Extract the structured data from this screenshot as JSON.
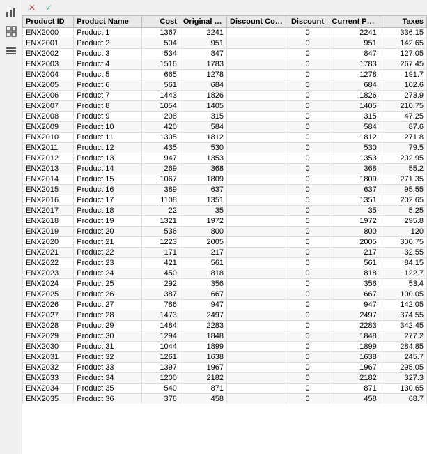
{
  "toolbar": {
    "chart_icon": "📊",
    "x_label": "✕",
    "check_label": "✓",
    "grid_icon": "⊞",
    "list_icon": "≡",
    "settings_icon": "⚙"
  },
  "table": {
    "columns": [
      {
        "key": "id",
        "label": "Product ID",
        "class": ""
      },
      {
        "key": "name",
        "label": "Product Name",
        "class": ""
      },
      {
        "key": "cost",
        "label": "Cost",
        "class": "num"
      },
      {
        "key": "orig_price",
        "label": "Original Sale Price",
        "class": "num"
      },
      {
        "key": "disc_code",
        "label": "Discount Code",
        "class": "center"
      },
      {
        "key": "discount",
        "label": "Discount",
        "class": "center"
      },
      {
        "key": "curr_price",
        "label": "Current Price",
        "class": "num"
      },
      {
        "key": "taxes",
        "label": "Taxes",
        "class": "num"
      }
    ],
    "rows": [
      {
        "id": "ENX2000",
        "name": "Product 1",
        "cost": "1367",
        "orig_price": "2241",
        "disc_code": "",
        "discount": "0",
        "curr_price": "2241",
        "taxes": "336.15"
      },
      {
        "id": "ENX2001",
        "name": "Product 2",
        "cost": "504",
        "orig_price": "951",
        "disc_code": "",
        "discount": "0",
        "curr_price": "951",
        "taxes": "142.65"
      },
      {
        "id": "ENX2002",
        "name": "Product 3",
        "cost": "534",
        "orig_price": "847",
        "disc_code": "",
        "discount": "0",
        "curr_price": "847",
        "taxes": "127.05"
      },
      {
        "id": "ENX2003",
        "name": "Product 4",
        "cost": "1516",
        "orig_price": "1783",
        "disc_code": "",
        "discount": "0",
        "curr_price": "1783",
        "taxes": "267.45"
      },
      {
        "id": "ENX2004",
        "name": "Product 5",
        "cost": "665",
        "orig_price": "1278",
        "disc_code": "",
        "discount": "0",
        "curr_price": "1278",
        "taxes": "191.7"
      },
      {
        "id": "ENX2005",
        "name": "Product 6",
        "cost": "561",
        "orig_price": "684",
        "disc_code": "",
        "discount": "0",
        "curr_price": "684",
        "taxes": "102.6"
      },
      {
        "id": "ENX2006",
        "name": "Product 7",
        "cost": "1443",
        "orig_price": "1826",
        "disc_code": "",
        "discount": "0",
        "curr_price": "1826",
        "taxes": "273.9"
      },
      {
        "id": "ENX2007",
        "name": "Product 8",
        "cost": "1054",
        "orig_price": "1405",
        "disc_code": "",
        "discount": "0",
        "curr_price": "1405",
        "taxes": "210.75"
      },
      {
        "id": "ENX2008",
        "name": "Product 9",
        "cost": "208",
        "orig_price": "315",
        "disc_code": "",
        "discount": "0",
        "curr_price": "315",
        "taxes": "47.25"
      },
      {
        "id": "ENX2009",
        "name": "Product 10",
        "cost": "420",
        "orig_price": "584",
        "disc_code": "",
        "discount": "0",
        "curr_price": "584",
        "taxes": "87.6"
      },
      {
        "id": "ENX2010",
        "name": "Product 11",
        "cost": "1305",
        "orig_price": "1812",
        "disc_code": "",
        "discount": "0",
        "curr_price": "1812",
        "taxes": "271.8"
      },
      {
        "id": "ENX2011",
        "name": "Product 12",
        "cost": "435",
        "orig_price": "530",
        "disc_code": "",
        "discount": "0",
        "curr_price": "530",
        "taxes": "79.5"
      },
      {
        "id": "ENX2012",
        "name": "Product 13",
        "cost": "947",
        "orig_price": "1353",
        "disc_code": "",
        "discount": "0",
        "curr_price": "1353",
        "taxes": "202.95"
      },
      {
        "id": "ENX2013",
        "name": "Product 14",
        "cost": "269",
        "orig_price": "368",
        "disc_code": "",
        "discount": "0",
        "curr_price": "368",
        "taxes": "55.2"
      },
      {
        "id": "ENX2014",
        "name": "Product 15",
        "cost": "1067",
        "orig_price": "1809",
        "disc_code": "",
        "discount": "0",
        "curr_price": "1809",
        "taxes": "271.35"
      },
      {
        "id": "ENX2015",
        "name": "Product 16",
        "cost": "389",
        "orig_price": "637",
        "disc_code": "",
        "discount": "0",
        "curr_price": "637",
        "taxes": "95.55"
      },
      {
        "id": "ENX2016",
        "name": "Product 17",
        "cost": "1108",
        "orig_price": "1351",
        "disc_code": "",
        "discount": "0",
        "curr_price": "1351",
        "taxes": "202.65"
      },
      {
        "id": "ENX2017",
        "name": "Product 18",
        "cost": "22",
        "orig_price": "35",
        "disc_code": "",
        "discount": "0",
        "curr_price": "35",
        "taxes": "5.25"
      },
      {
        "id": "ENX2018",
        "name": "Product 19",
        "cost": "1321",
        "orig_price": "1972",
        "disc_code": "",
        "discount": "0",
        "curr_price": "1972",
        "taxes": "295.8"
      },
      {
        "id": "ENX2019",
        "name": "Product 20",
        "cost": "536",
        "orig_price": "800",
        "disc_code": "",
        "discount": "0",
        "curr_price": "800",
        "taxes": "120"
      },
      {
        "id": "ENX2020",
        "name": "Product 21",
        "cost": "1223",
        "orig_price": "2005",
        "disc_code": "",
        "discount": "0",
        "curr_price": "2005",
        "taxes": "300.75"
      },
      {
        "id": "ENX2021",
        "name": "Product 22",
        "cost": "171",
        "orig_price": "217",
        "disc_code": "",
        "discount": "0",
        "curr_price": "217",
        "taxes": "32.55"
      },
      {
        "id": "ENX2022",
        "name": "Product 23",
        "cost": "421",
        "orig_price": "561",
        "disc_code": "",
        "discount": "0",
        "curr_price": "561",
        "taxes": "84.15"
      },
      {
        "id": "ENX2023",
        "name": "Product 24",
        "cost": "450",
        "orig_price": "818",
        "disc_code": "",
        "discount": "0",
        "curr_price": "818",
        "taxes": "122.7"
      },
      {
        "id": "ENX2024",
        "name": "Product 25",
        "cost": "292",
        "orig_price": "356",
        "disc_code": "",
        "discount": "0",
        "curr_price": "356",
        "taxes": "53.4"
      },
      {
        "id": "ENX2025",
        "name": "Product 26",
        "cost": "387",
        "orig_price": "667",
        "disc_code": "",
        "discount": "0",
        "curr_price": "667",
        "taxes": "100.05"
      },
      {
        "id": "ENX2026",
        "name": "Product 27",
        "cost": "786",
        "orig_price": "947",
        "disc_code": "",
        "discount": "0",
        "curr_price": "947",
        "taxes": "142.05"
      },
      {
        "id": "ENX2027",
        "name": "Product 28",
        "cost": "1473",
        "orig_price": "2497",
        "disc_code": "",
        "discount": "0",
        "curr_price": "2497",
        "taxes": "374.55"
      },
      {
        "id": "ENX2028",
        "name": "Product 29",
        "cost": "1484",
        "orig_price": "2283",
        "disc_code": "",
        "discount": "0",
        "curr_price": "2283",
        "taxes": "342.45"
      },
      {
        "id": "ENX2029",
        "name": "Product 30",
        "cost": "1294",
        "orig_price": "1848",
        "disc_code": "",
        "discount": "0",
        "curr_price": "1848",
        "taxes": "277.2"
      },
      {
        "id": "ENX2030",
        "name": "Product 31",
        "cost": "1044",
        "orig_price": "1899",
        "disc_code": "",
        "discount": "0",
        "curr_price": "1899",
        "taxes": "284.85"
      },
      {
        "id": "ENX2031",
        "name": "Product 32",
        "cost": "1261",
        "orig_price": "1638",
        "disc_code": "",
        "discount": "0",
        "curr_price": "1638",
        "taxes": "245.7"
      },
      {
        "id": "ENX2032",
        "name": "Product 33",
        "cost": "1397",
        "orig_price": "1967",
        "disc_code": "",
        "discount": "0",
        "curr_price": "1967",
        "taxes": "295.05"
      },
      {
        "id": "ENX2033",
        "name": "Product 34",
        "cost": "1200",
        "orig_price": "2182",
        "disc_code": "",
        "discount": "0",
        "curr_price": "2182",
        "taxes": "327.3"
      },
      {
        "id": "ENX2034",
        "name": "Product 35",
        "cost": "540",
        "orig_price": "871",
        "disc_code": "",
        "discount": "0",
        "curr_price": "871",
        "taxes": "130.65"
      },
      {
        "id": "ENX2035",
        "name": "Product 36",
        "cost": "376",
        "orig_price": "458",
        "disc_code": "",
        "discount": "0",
        "curr_price": "458",
        "taxes": "68.7"
      }
    ]
  }
}
